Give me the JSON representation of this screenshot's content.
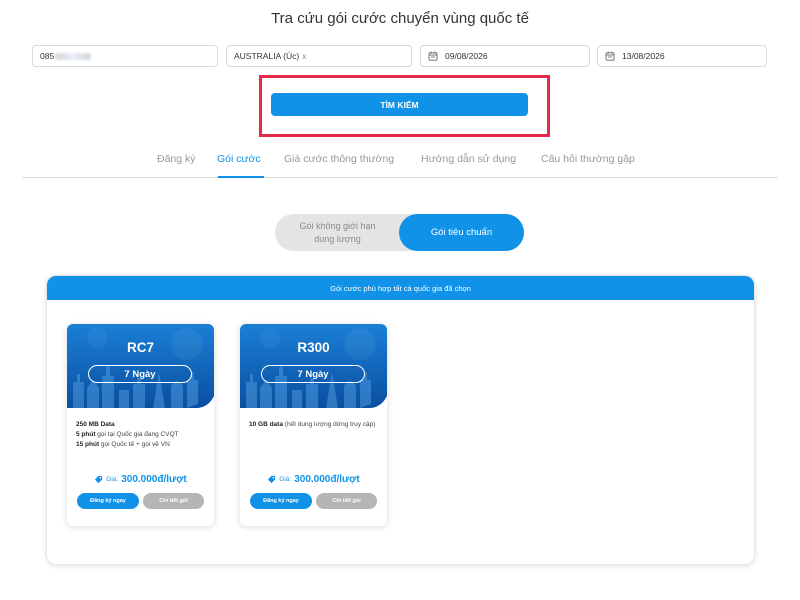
{
  "page": {
    "title": "Tra cứu gói cước chuyển vùng quốc tế"
  },
  "search_form": {
    "phone_prefix": "085",
    "country": "AUSTRALIA (Úc)",
    "country_remove": "x",
    "start_date": "09/08/2026",
    "end_date": "13/08/2026",
    "search_label": "TÌM KIẾM"
  },
  "tabs": [
    {
      "label": "Đăng ký",
      "active": false
    },
    {
      "label": "Gói cước",
      "active": true
    },
    {
      "label": "Giá cước thông thường",
      "active": false
    },
    {
      "label": "Hướng dẫn sử dụng",
      "active": false
    },
    {
      "label": "Câu hỏi thường gặp",
      "active": false
    }
  ],
  "package_toggle": {
    "option_unlimited_line1": "Gói không giới hạn",
    "option_unlimited_line2": "dung lượng",
    "option_standard": "Gói tiêu chuẩn",
    "selected": "option_standard"
  },
  "results": {
    "header": "Gói cước phù hợp tất cả quốc gia đã chọn",
    "packages": [
      {
        "name": "RC7",
        "duration": "7 Ngày",
        "desc_lines": [
          {
            "bold": "250 MB Data",
            "text": ""
          },
          {
            "bold": "5 phút",
            "text": " gọi tại Quốc gia đang CVQT"
          },
          {
            "bold": "15 phút",
            "text": " gọi Quốc tế + gọi về VN"
          }
        ],
        "price_label": "Giá:",
        "price": "300.000đ/lượt",
        "register_label": "Đăng ký ngay",
        "detail_label": "Chi tiết gói"
      },
      {
        "name": "R300",
        "duration": "7 Ngày",
        "desc_lines": [
          {
            "bold": "10 GB data",
            "text": " (hết dung lượng dừng truy cập)"
          }
        ],
        "price_label": "Giá:",
        "price": "300.000đ/lượt",
        "register_label": "Đăng ký ngay",
        "detail_label": "Chi tiết gói"
      }
    ]
  },
  "colors": {
    "primary": "#0f92e8",
    "highlight_border": "#e8284a",
    "muted_text": "#9a9a9a",
    "secondary_button": "#b5b5b5"
  },
  "icons": {
    "date": "calendar-icon",
    "price": "price-tag-icon"
  }
}
